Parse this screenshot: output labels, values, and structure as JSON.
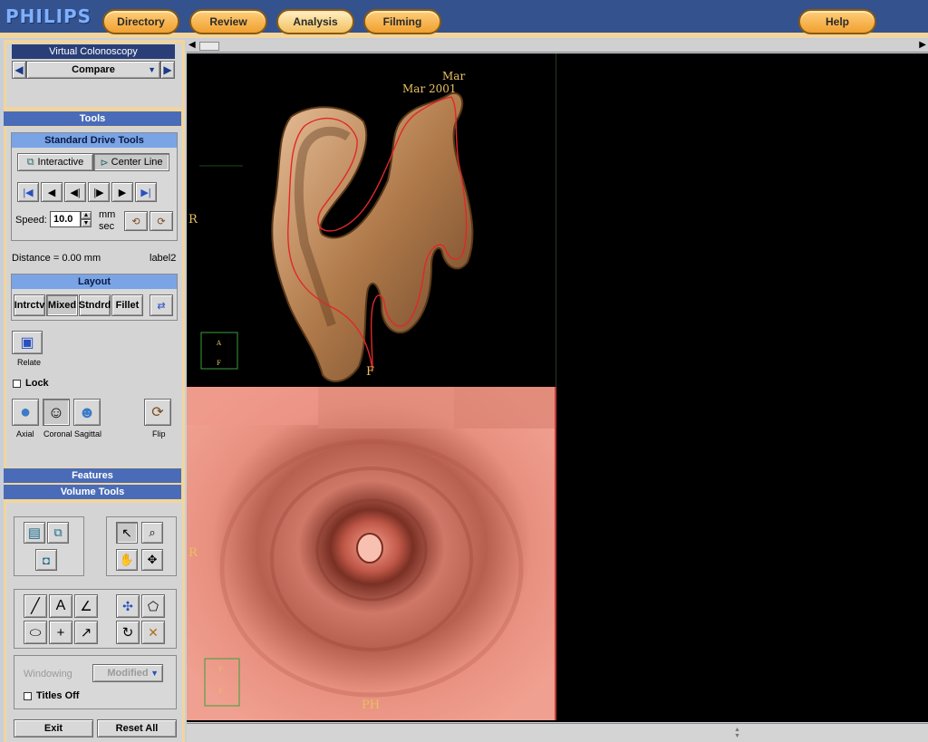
{
  "app": {
    "logo": "PHILIPS"
  },
  "nav": {
    "directory": "Directory",
    "review": "Review",
    "analysis": "Analysis",
    "filming": "Filming",
    "help": "Help"
  },
  "sidebar": {
    "module_title": "Virtual Colonoscopy",
    "mode_value": "Compare",
    "tools_header": "Tools",
    "drive_tools_header": "Standard Drive Tools",
    "interactive_label": "Interactive",
    "centerline_label": "Center Line",
    "speed_label": "Speed:",
    "speed_value": "10.0",
    "speed_unit_top": "mm",
    "speed_unit_bottom": "sec",
    "distance_text": "Distance = 0.00 mm",
    "label2": "label2",
    "layout_header": "Layout",
    "layout_buttons": [
      "Intrctv",
      "Mixed",
      "Stndrd",
      "Fillet"
    ],
    "relate_label": "Relate",
    "lock_label": "Lock",
    "axial_label": "Axial",
    "coronal_label": "Coronal",
    "sagittal_label": "Sagittal",
    "flip_label": "Flip",
    "features_header": "Features",
    "volume_tools_header": "Volume Tools",
    "windowing_label": "Windowing",
    "windowing_value": "Modified",
    "titles_off_label": "Titles Off",
    "exit_label": "Exit",
    "reset_all_label": "Reset All"
  },
  "viewer": {
    "top_left_marker": "R",
    "top_annotation_1": "Mar",
    "top_annotation_2": "Mar 2001",
    "top_bottom_marker": "F",
    "bottom_left_marker": "R",
    "bottom_bottom_marker": "PH",
    "orient_top_a": "A",
    "orient_top_r": "F",
    "orient_bot_a": "F",
    "orient_bot_r": "F"
  },
  "colors": {
    "accent_orange": "#f0a030",
    "panel_tan": "#f2d59c",
    "header_navy": "#2a3f78",
    "colon_surface": "#c98a5a",
    "endo_pink": "#e08070"
  },
  "icons": [
    "save-icon",
    "camera-series-icon",
    "camera-icon",
    "pointer-icon",
    "zoom-icon",
    "pan-hand-icon",
    "window-level-icon",
    "line-icon",
    "text-icon",
    "angle-icon",
    "ellipse-icon",
    "crosshair-icon",
    "arrow-icon",
    "move-icon",
    "polygon-icon",
    "rotate-icon",
    "delete-annotation-icon"
  ]
}
